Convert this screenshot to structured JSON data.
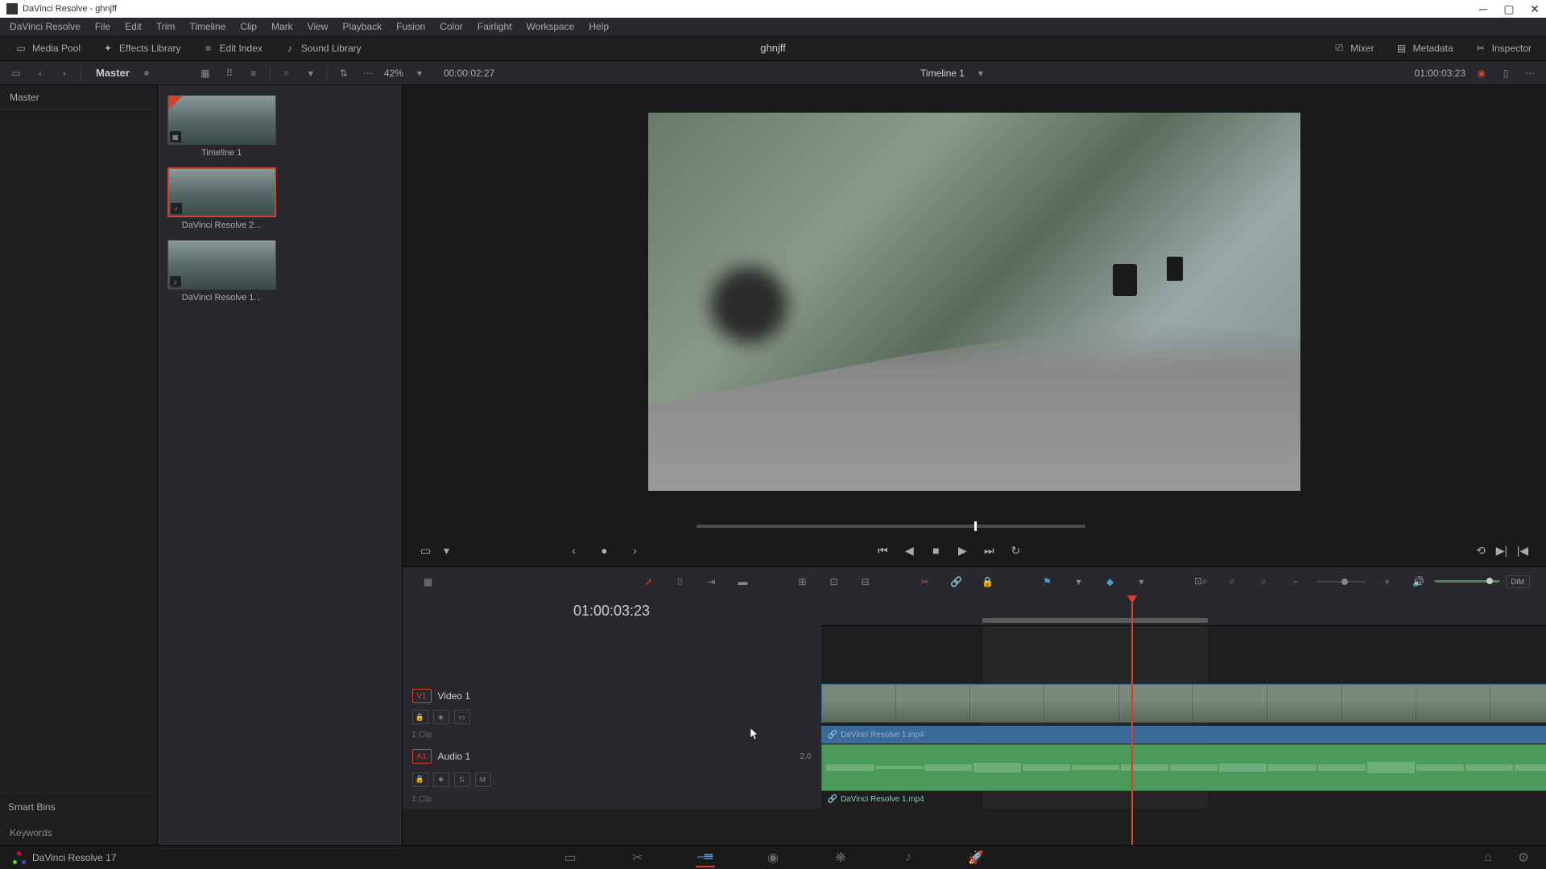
{
  "app": {
    "title": "DaVinci Resolve - ghnjff",
    "project": "ghnjff"
  },
  "menubar": [
    "DaVinci Resolve",
    "File",
    "Edit",
    "Trim",
    "Timeline",
    "Clip",
    "Mark",
    "View",
    "Playback",
    "Fusion",
    "Color",
    "Fairlight",
    "Workspace",
    "Help"
  ],
  "toolbar": {
    "media_pool": "Media Pool",
    "effects_library": "Effects Library",
    "edit_index": "Edit Index",
    "sound_library": "Sound Library",
    "mixer": "Mixer",
    "metadata": "Metadata",
    "inspector": "Inspector"
  },
  "subtoolbar": {
    "master": "Master",
    "zoom": "42%",
    "source_tc": "00:00:02:27",
    "timeline_name": "Timeline 1",
    "record_tc": "01:00:03:23"
  },
  "bins": {
    "master": "Master",
    "smart_bins": "Smart Bins",
    "keywords": "Keywords"
  },
  "clips": [
    {
      "label": "Timeline 1",
      "type": "timeline"
    },
    {
      "label": "DaVinci Resolve 2...",
      "type": "video",
      "selected": true
    },
    {
      "label": "DaVinci Resolve 1...",
      "type": "video"
    }
  ],
  "timeline": {
    "tc": "01:00:03:23",
    "v1": {
      "badge": "V1",
      "name": "Video 1",
      "clip_label": "DaVinci Resolve 1.mp4",
      "clips": "1 Clip"
    },
    "a1": {
      "badge": "A1",
      "name": "Audio 1",
      "level": "2.0",
      "clip_label": "DaVinci Resolve 1.mp4",
      "clips": "1 Clip"
    }
  },
  "bottom": {
    "version": "DaVinci Resolve 17"
  }
}
